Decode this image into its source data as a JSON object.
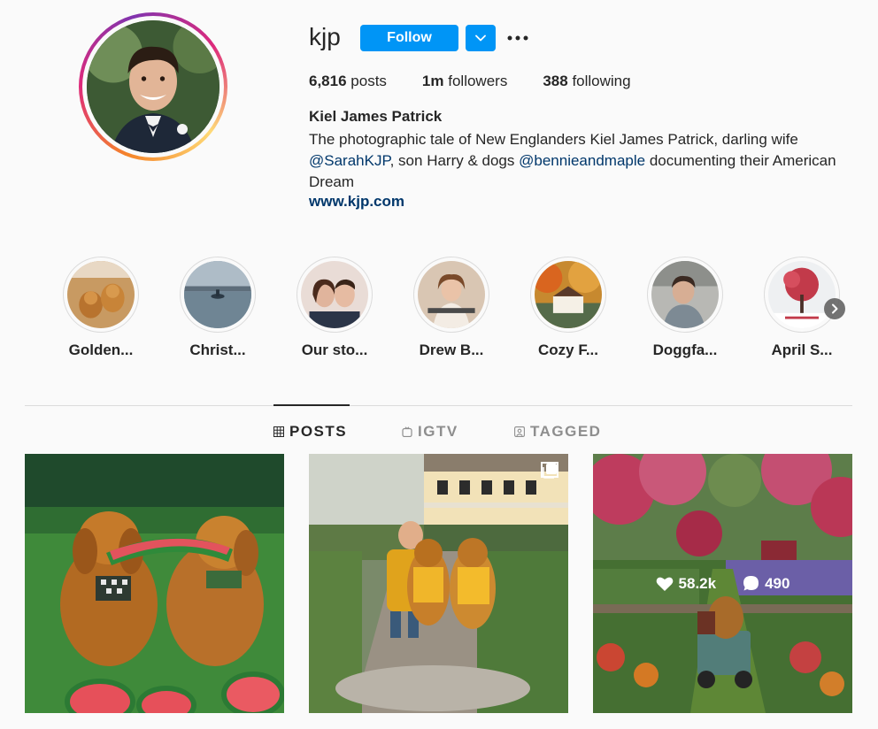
{
  "profile": {
    "username": "kjp",
    "follow_label": "Follow",
    "full_name": "Kiel James Patrick",
    "bio_part1": "The photographic tale of New Englanders Kiel James Patrick, darling wife ",
    "bio_mention1": "@SarahKJP",
    "bio_part2": ", son Harry & dogs ",
    "bio_mention2": "@bennieandmaple",
    "bio_part3": " documenting their American Dream",
    "website": "www.kjp.com"
  },
  "stats": {
    "posts_count": "6,816",
    "posts_label": "posts",
    "followers_count": "1m",
    "followers_label": "followers",
    "following_count": "388",
    "following_label": "following"
  },
  "highlights": [
    {
      "label": "Golden..."
    },
    {
      "label": "Christ..."
    },
    {
      "label": "Our sto..."
    },
    {
      "label": "Drew B..."
    },
    {
      "label": "Cozy F..."
    },
    {
      "label": "Doggfa..."
    },
    {
      "label": "April S..."
    }
  ],
  "tabs": [
    {
      "label": "POSTS",
      "active": true
    },
    {
      "label": "IGTV",
      "active": false
    },
    {
      "label": "TAGGED",
      "active": false
    }
  ],
  "posts": [
    {
      "likes": "",
      "comments": ""
    },
    {
      "likes": "",
      "comments": ""
    },
    {
      "likes": "58.2k",
      "comments": "490"
    }
  ],
  "colors": {
    "accent": "#0095f6",
    "link": "#00376b",
    "text": "#262626",
    "muted": "#8e8e8e",
    "divider": "#dbdbdb"
  },
  "icons": {
    "more": "more-horizontal-icon",
    "dropdown": "chevron-down-icon",
    "posts_tab": "grid-icon",
    "igtv_tab": "igtv-icon",
    "tagged_tab": "tagged-user-icon",
    "highlights_next": "chevron-right-icon",
    "likes": "heart-icon",
    "comments": "comment-bubble-icon",
    "multi_post": "multiple-posts-icon"
  }
}
